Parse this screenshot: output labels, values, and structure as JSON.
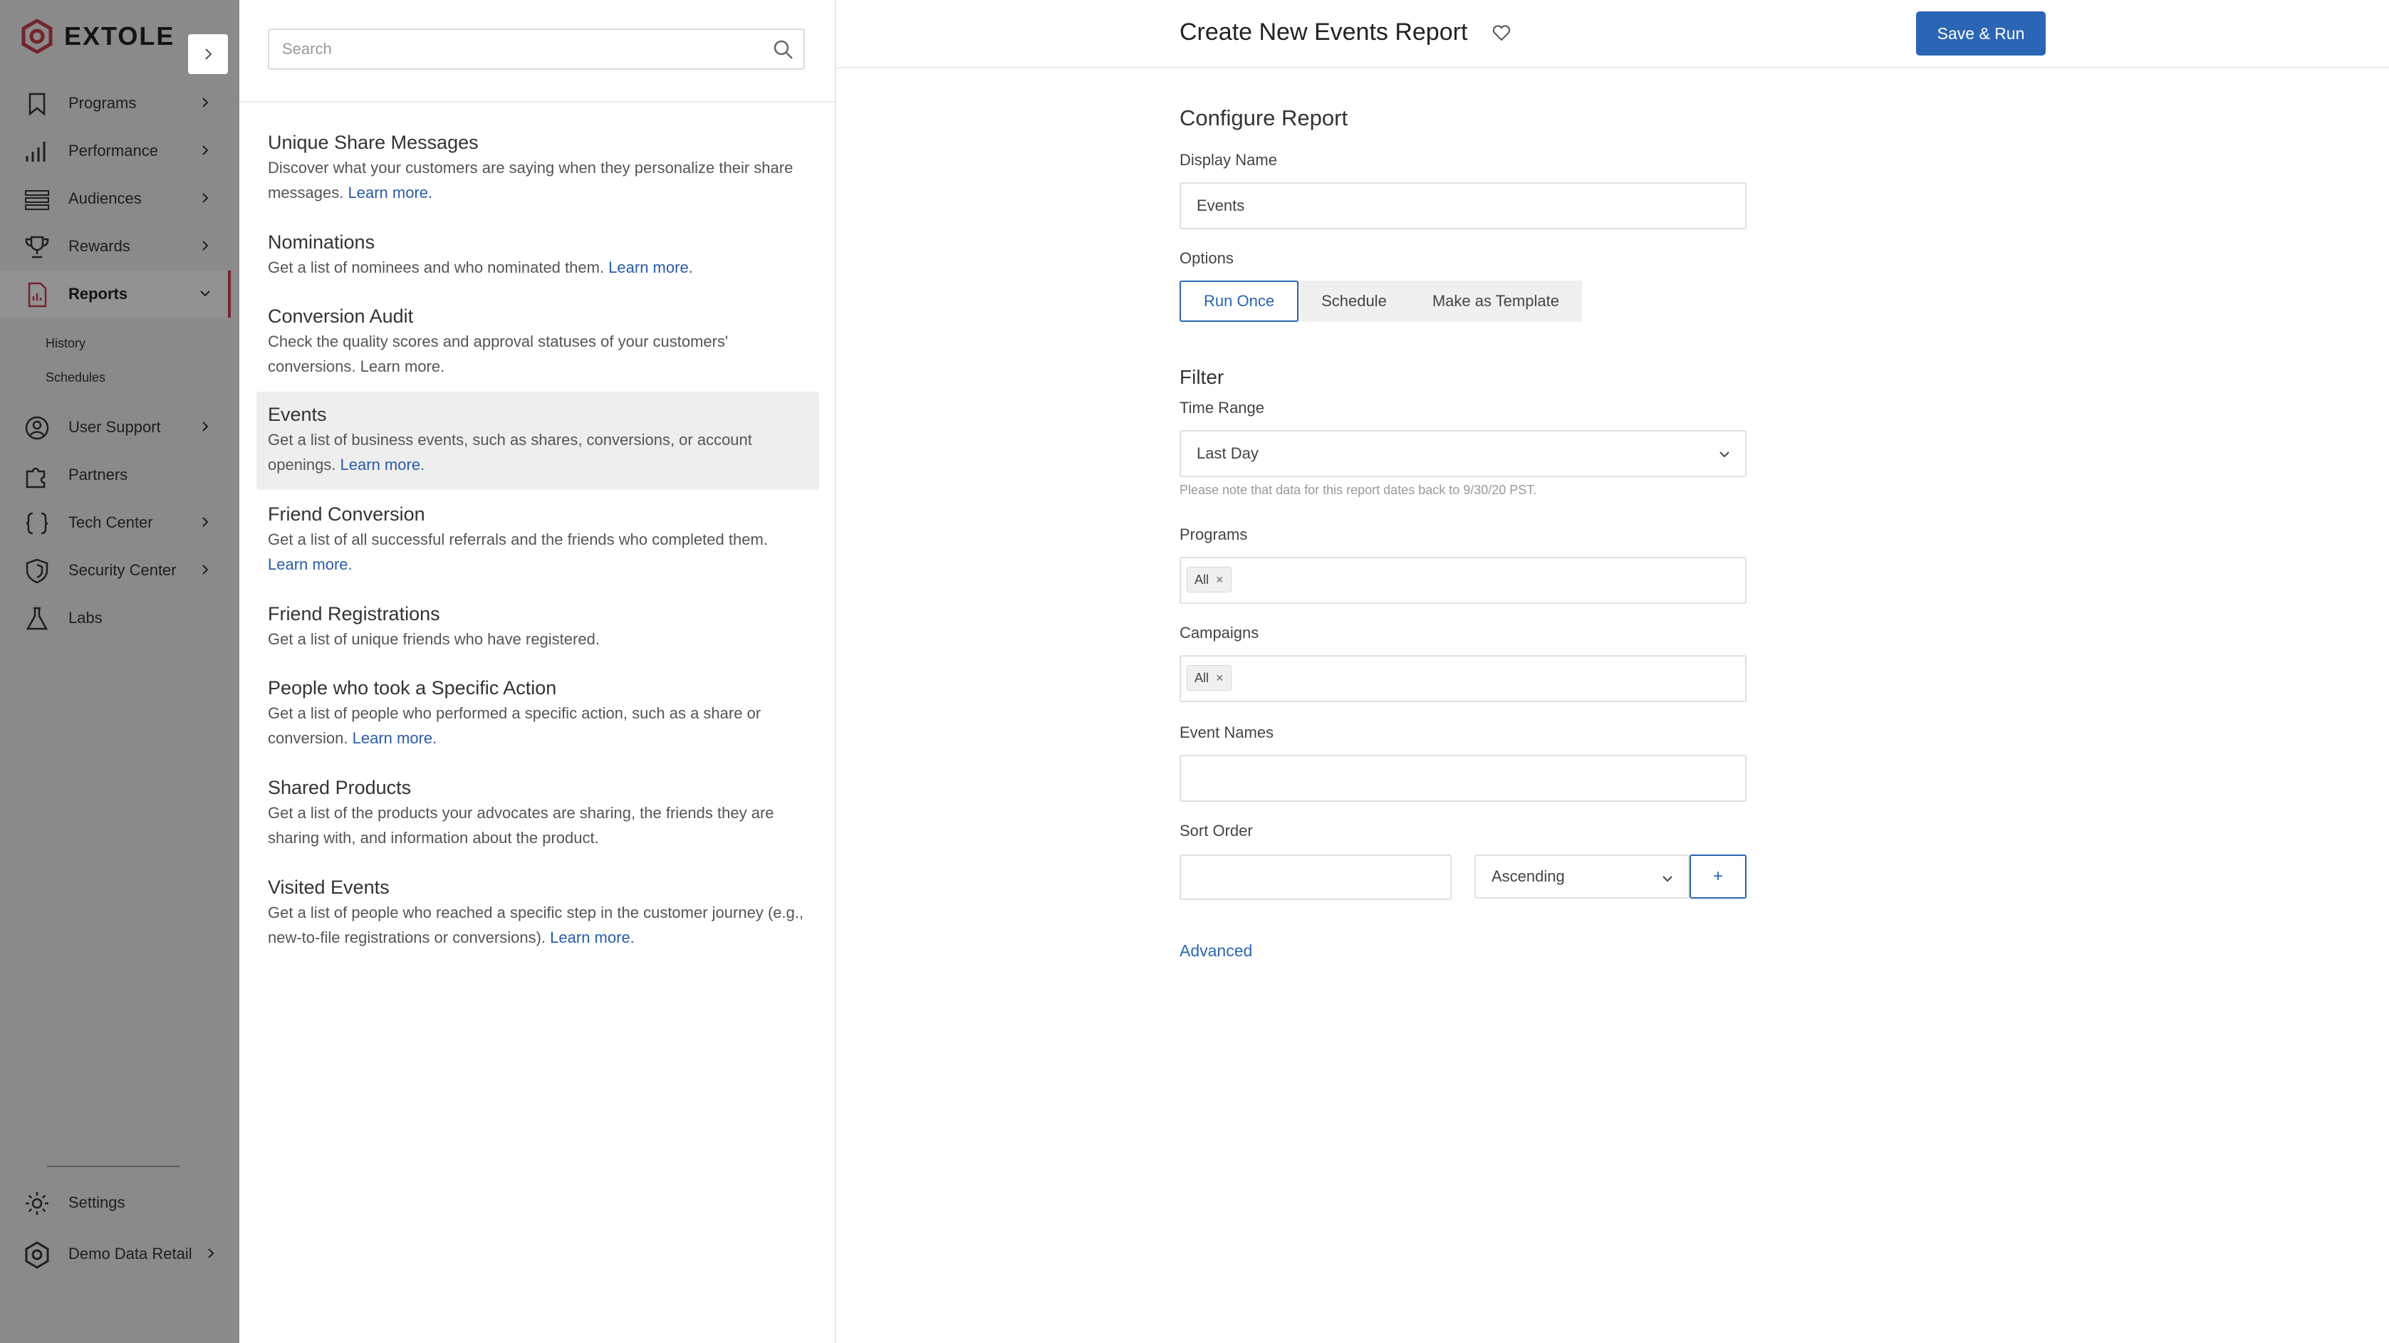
{
  "sidebar": {
    "brand": "EXTOLE",
    "items": [
      {
        "label": "Programs",
        "icon": "bookmark-icon"
      },
      {
        "label": "Performance",
        "icon": "bar-chart-icon"
      },
      {
        "label": "Audiences",
        "icon": "audiences-icon"
      },
      {
        "label": "Rewards",
        "icon": "trophy-icon"
      },
      {
        "label": "Reports",
        "icon": "report-icon"
      },
      {
        "label": "User Support",
        "icon": "user-support-icon"
      },
      {
        "label": "Partners",
        "icon": "puzzle-icon"
      },
      {
        "label": "Tech Center",
        "icon": "code-braces-icon"
      },
      {
        "label": "Security Center",
        "icon": "shield-icon"
      },
      {
        "label": "Labs",
        "icon": "flask-icon"
      }
    ],
    "sub_items": [
      "History",
      "Schedules"
    ],
    "settings_label": "Settings",
    "account_label": "Demo Data Retail",
    "accent_color": "#c23b4b"
  },
  "panel": {
    "search_placeholder": "Search",
    "reports": [
      {
        "title": "Unique Share Messages",
        "desc": "Discover what your customers are saying when they personalize their share messages.",
        "link": "Learn more."
      },
      {
        "title": "Nominations",
        "desc": "Get a list of nominees and who nominated them.",
        "link": "Learn more."
      },
      {
        "title": "Conversion Audit",
        "desc": "Check the quality scores and approval statuses of your customers' conversions. Learn more.",
        "link": ""
      },
      {
        "title": "Events",
        "desc": "Get a list of business events, such as shares, conversions, or account openings.",
        "link": "Learn more."
      },
      {
        "title": "Friend Conversion",
        "desc": "Get a list of all successful referrals and the friends who completed them.",
        "link": "Learn more."
      },
      {
        "title": "Friend Registrations",
        "desc": "Get a list of unique friends who have registered.",
        "link": ""
      },
      {
        "title": "People who took a Specific Action",
        "desc": "Get a list of people who performed a specific action, such as a share or conversion.",
        "link": "Learn more."
      },
      {
        "title": "Shared Products",
        "desc": "Get a list of the products your advocates are sharing, the friends they are sharing with, and information about the product.",
        "link": ""
      },
      {
        "title": "Visited Events",
        "desc": "Get a list of people who reached a specific step in the customer journey (e.g., new-to-file registrations or conversions).",
        "link": "Learn more."
      }
    ]
  },
  "main": {
    "title": "Create New Events Report",
    "save_label": "Save & Run",
    "configure_heading": "Configure Report",
    "display_name_label": "Display Name",
    "display_name_value": "Events",
    "options_label": "Options",
    "options": [
      "Run Once",
      "Schedule",
      "Make as Template"
    ],
    "filter_heading": "Filter",
    "time_range_label": "Time Range",
    "time_range_value": "Last Day",
    "note": "Please note that data for this report dates back to 9/30/20 PST.",
    "programs_label": "Programs",
    "programs_tag": "All",
    "campaigns_label": "Campaigns",
    "campaigns_tag": "All",
    "tag_remove": "×",
    "event_names_label": "Event Names",
    "sort_order_label": "Sort Order",
    "sort_direction": "Ascending",
    "add_label": "+",
    "advanced_label": "Advanced",
    "primary_color": "#2b65b5"
  }
}
